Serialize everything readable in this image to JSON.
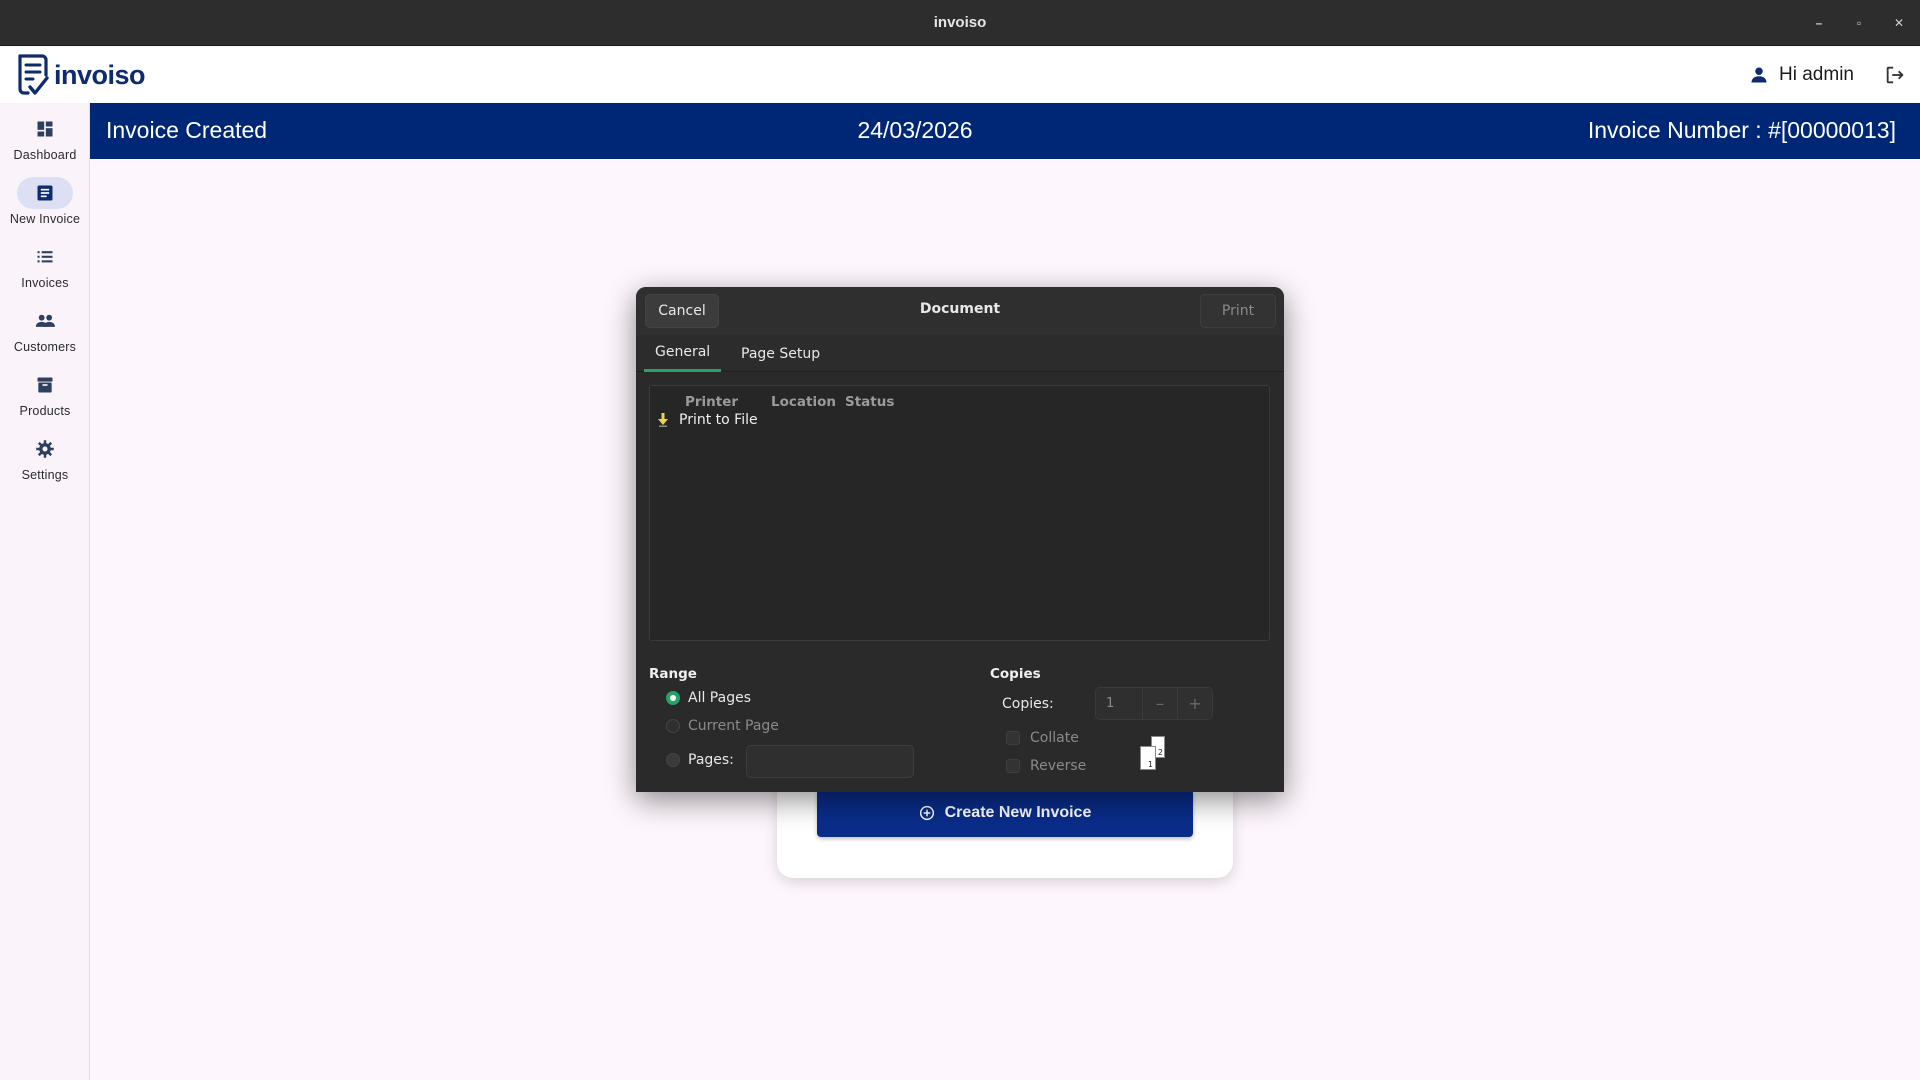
{
  "window": {
    "title": "invoiso",
    "minimize_glyph": "–",
    "maximize_glyph": "▫",
    "close_glyph": "✕"
  },
  "header": {
    "app_name": "invoiso",
    "greeting": "Hi admin"
  },
  "sidebar": {
    "items": [
      {
        "label": "Dashboard",
        "icon": "dashboard-icon"
      },
      {
        "label": "New Invoice",
        "icon": "new-invoice-icon",
        "active": true
      },
      {
        "label": "Invoices",
        "icon": "list-icon"
      },
      {
        "label": "Customers",
        "icon": "people-icon"
      },
      {
        "label": "Products",
        "icon": "archive-icon"
      },
      {
        "label": "Settings",
        "icon": "gear-icon"
      }
    ]
  },
  "banner": {
    "status": "Invoice Created",
    "date": "24/03/2026",
    "invoice_number": "Invoice Number : #[00000013]"
  },
  "card": {
    "create_button": "Create New Invoice"
  },
  "print_dialog": {
    "cancel": "Cancel",
    "title": "Document",
    "print": "Print",
    "tabs": [
      "General",
      "Page Setup"
    ],
    "columns": {
      "printer": "Printer",
      "location": "Location",
      "status": "Status"
    },
    "printers": [
      {
        "name": "Print to File"
      }
    ],
    "range": {
      "title": "Range",
      "all_pages": "All Pages",
      "current_page": "Current Page",
      "pages": "Pages:",
      "selected": "All Pages"
    },
    "copies": {
      "title": "Copies",
      "label": "Copies:",
      "value": "1",
      "collate": "Collate",
      "reverse": "Reverse",
      "page_labels": [
        "1",
        "2"
      ]
    }
  },
  "colors": {
    "banner": "#002776",
    "brand": "#0d2b6e",
    "accent_green": "#26a269",
    "create_button": "#0a2d8a"
  }
}
